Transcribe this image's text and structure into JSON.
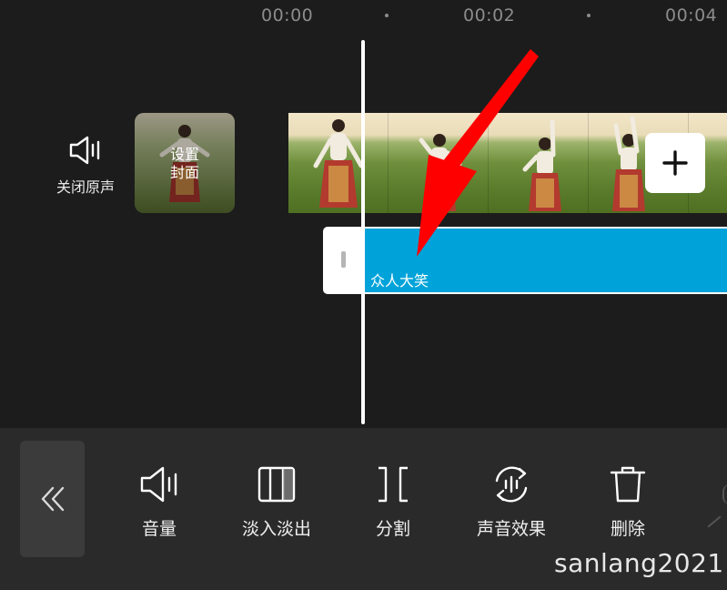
{
  "ruler": {
    "ticks": [
      "00:00",
      "00:02",
      "00:04"
    ]
  },
  "track": {
    "mute_label": "关闭原声",
    "cover_label_line1": "设置",
    "cover_label_line2": "封面",
    "add_clip_icon": "plus-icon"
  },
  "audio": {
    "clip_name": "众人大笑",
    "clip_color": "#00a3d9"
  },
  "toolbar": {
    "back_icon": "double-chevron-left-icon",
    "items": [
      {
        "label": "音量",
        "icon": "speaker-icon"
      },
      {
        "label": "淡入淡出",
        "icon": "fade-icon"
      },
      {
        "label": "分割",
        "icon": "split-icon"
      },
      {
        "label": "声音效果",
        "icon": "voice-effect-icon"
      },
      {
        "label": "删除",
        "icon": "trash-icon"
      }
    ]
  },
  "annotation": {
    "arrow_color": "#ff0000"
  },
  "watermark": "sanlang2021"
}
